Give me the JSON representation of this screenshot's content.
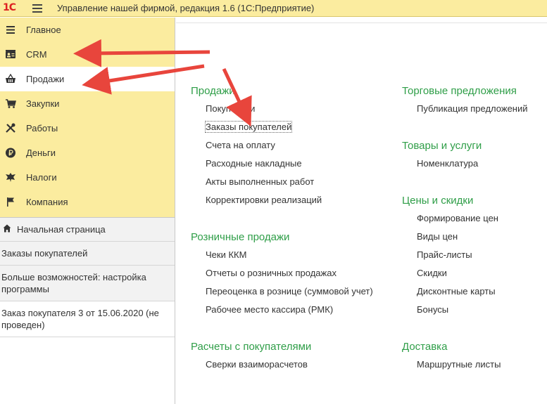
{
  "app": {
    "logo_text": "1С",
    "title": "Управление нашей фирмой, редакция 1.6  (1С:Предприятие)"
  },
  "sections": [
    {
      "label": "Главное",
      "icon": "menu-lines-icon"
    },
    {
      "label": "CRM",
      "icon": "contact-card-icon"
    },
    {
      "label": "Продажи",
      "icon": "basket-icon"
    },
    {
      "label": "Закупки",
      "icon": "cart-icon"
    },
    {
      "label": "Работы",
      "icon": "tools-icon"
    },
    {
      "label": "Деньги",
      "icon": "ruble-coin-icon"
    },
    {
      "label": "Налоги",
      "icon": "emblem-icon"
    },
    {
      "label": "Компания",
      "icon": "flag-icon"
    }
  ],
  "open_windows": [
    {
      "label": "Начальная страница"
    },
    {
      "label": "Заказы покупателей"
    },
    {
      "label": "Больше возможностей: настройка программы"
    },
    {
      "label": "Заказ покупателя 3 от 15.06.2020 (не проведен)"
    }
  ],
  "groups": {
    "sales": {
      "title": "Продажи",
      "links": [
        "Покупатели",
        "Заказы покупателей",
        "Счета на оплату",
        "Расходные накладные",
        "Акты выполненных работ",
        "Корректировки реализаций"
      ]
    },
    "retail": {
      "title": "Розничные продажи",
      "links": [
        "Чеки ККМ",
        "Отчеты о розничных продажах",
        "Переоценка в рознице (суммовой учет)",
        "Рабочее место кассира (РМК)"
      ]
    },
    "settlements": {
      "title": "Расчеты с покупателями",
      "links": [
        "Сверки взаиморасчетов"
      ]
    },
    "offers": {
      "title": "Торговые предложения",
      "links": [
        "Публикация предложений"
      ]
    },
    "goods": {
      "title": "Товары и услуги",
      "links": [
        "Номенклатура"
      ]
    },
    "prices": {
      "title": "Цены и скидки",
      "links": [
        "Формирование цен",
        "Виды цен",
        "Прайс-листы",
        "Скидки",
        "Дисконтные карты",
        "Бонусы"
      ]
    },
    "delivery": {
      "title": "Доставка",
      "links": [
        "Маршрутные листы"
      ]
    }
  },
  "colors": {
    "section_bg": "#fbec9f",
    "group_title": "#2f9e48",
    "arrow": "#e8453c"
  }
}
